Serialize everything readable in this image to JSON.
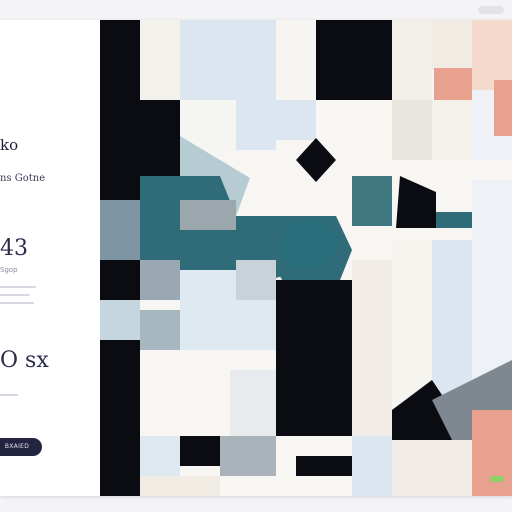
{
  "sidebar": {
    "title": "ko",
    "subtitle": "ns Gotne",
    "stat_primary": {
      "value": "43",
      "label": "Sgop"
    },
    "stat_secondary": {
      "value": "O sx"
    },
    "cta_label": "BXAIED"
  },
  "colors": {
    "accent": "#2f6b78",
    "dark": "#0b0b12",
    "light_blue": "#dce6f0",
    "cream": "#f2efe8",
    "peach": "#e8a18e",
    "grey": "#a0a7ad",
    "navy_button": "#23243f"
  }
}
